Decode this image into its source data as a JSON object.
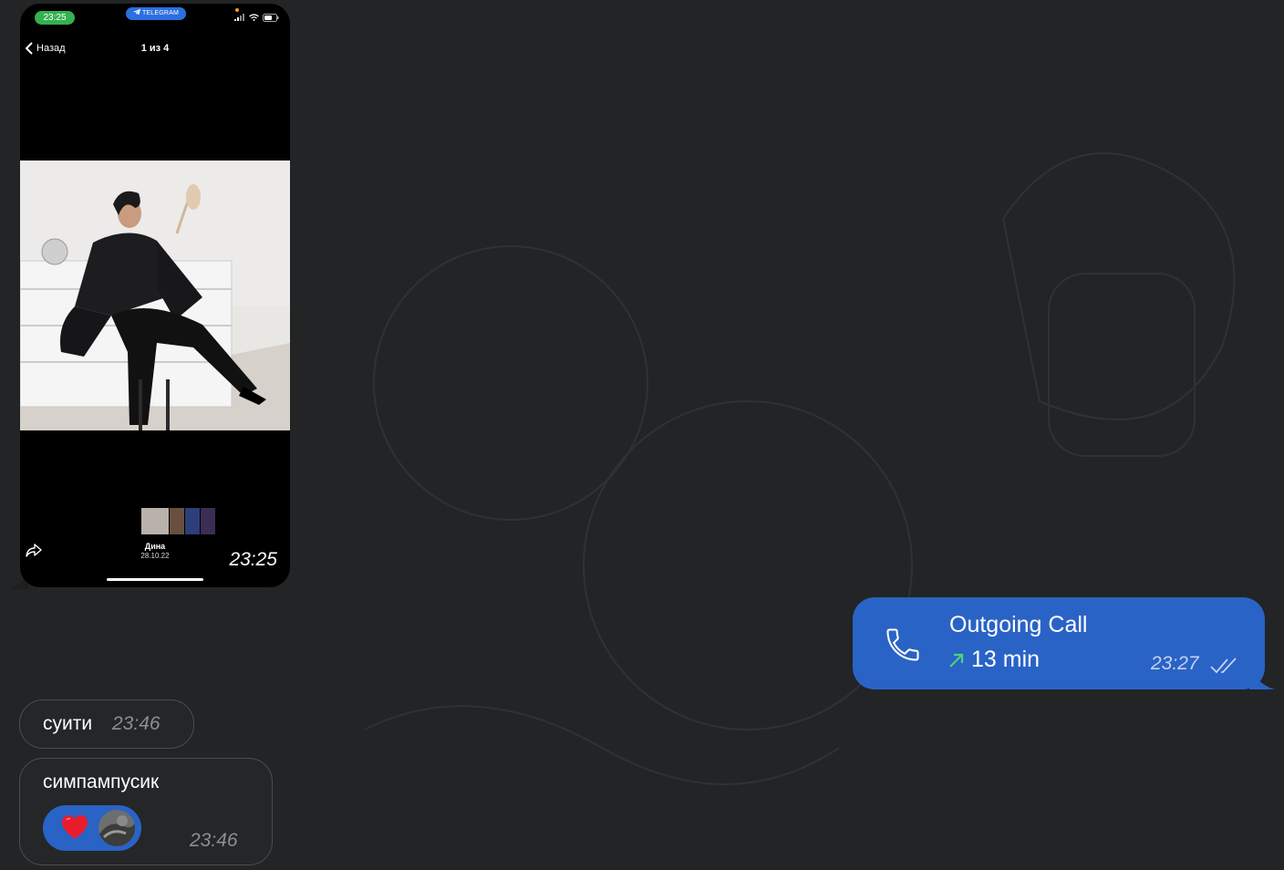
{
  "photo_message": {
    "phone_status_time": "23:25",
    "phone_app_badge": "TELEGRAM",
    "back_label": "Назад",
    "counter": "1 из 4",
    "author": "Дина",
    "date": "28.10.22",
    "time": "23:25",
    "icons": [
      "chevron-left-icon",
      "telegram-icon",
      "signal-icon",
      "wifi-icon",
      "battery-icon",
      "share-icon"
    ]
  },
  "outgoing_call": {
    "title": "Outgoing Call",
    "duration": "13 min",
    "time": "23:27",
    "icons": [
      "phone-icon",
      "outgoing-arrow-icon",
      "double-check-icon"
    ],
    "colors": {
      "bubble": "#2a63c6",
      "arrow": "#4cd07d"
    }
  },
  "messages": [
    {
      "text": "суити",
      "time": "23:46"
    },
    {
      "text": "симпампусик",
      "time": "23:46",
      "reaction": {
        "emoji": "❤️",
        "icons": [
          "heart-icon",
          "avatar"
        ]
      }
    }
  ],
  "colors": {
    "background": "#222426",
    "incoming_bubble_border": "#4a4c4f"
  }
}
